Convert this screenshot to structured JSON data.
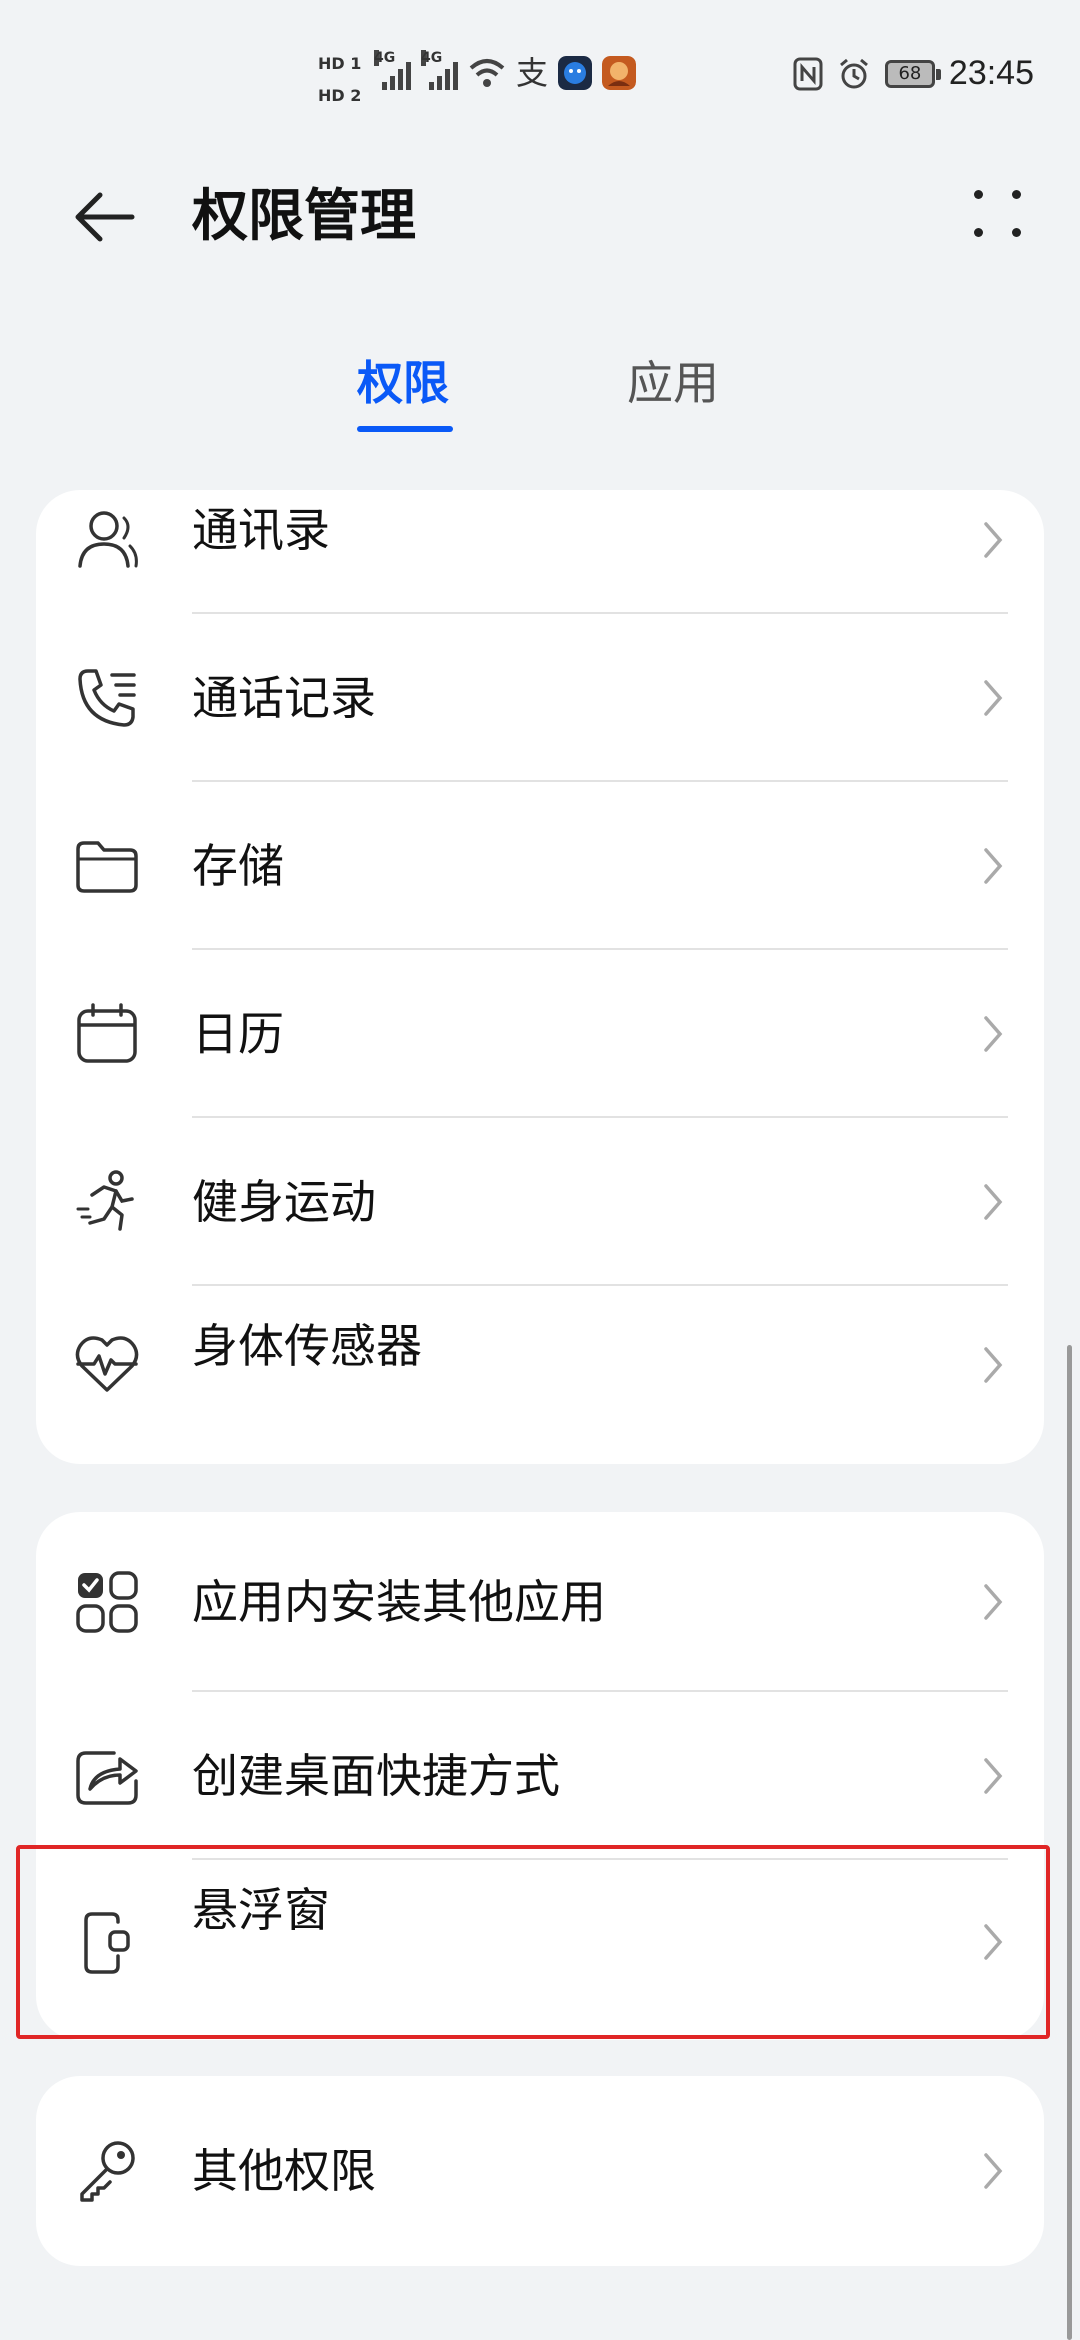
{
  "status_bar": {
    "hd1": "HD 1",
    "hd2": "HD 2",
    "net1": "4G",
    "net2": "4G",
    "battery": "68",
    "time": "23:45"
  },
  "header": {
    "title": "权限管理"
  },
  "tabs": [
    {
      "label": "权限",
      "active": true
    },
    {
      "label": "应用",
      "active": false
    }
  ],
  "cards": [
    {
      "items": [
        {
          "label": "通讯录",
          "icon": "contacts-icon"
        },
        {
          "label": "通话记录",
          "icon": "call-log-icon"
        },
        {
          "label": "存储",
          "icon": "folder-icon"
        },
        {
          "label": "日历",
          "icon": "calendar-icon"
        },
        {
          "label": "健身运动",
          "icon": "running-icon"
        },
        {
          "label": "身体传感器",
          "icon": "heart-rate-icon"
        }
      ]
    },
    {
      "items": [
        {
          "label": "应用内安装其他应用",
          "icon": "app-install-icon"
        },
        {
          "label": "创建桌面快捷方式",
          "icon": "shortcut-icon"
        },
        {
          "label": "悬浮窗",
          "icon": "floating-window-icon"
        }
      ]
    },
    {
      "items": [
        {
          "label": "其他权限",
          "icon": "key-icon"
        }
      ]
    }
  ],
  "colors": {
    "accent": "#0a59f7",
    "highlight": "#e02626",
    "background": "#f1f3f5"
  }
}
